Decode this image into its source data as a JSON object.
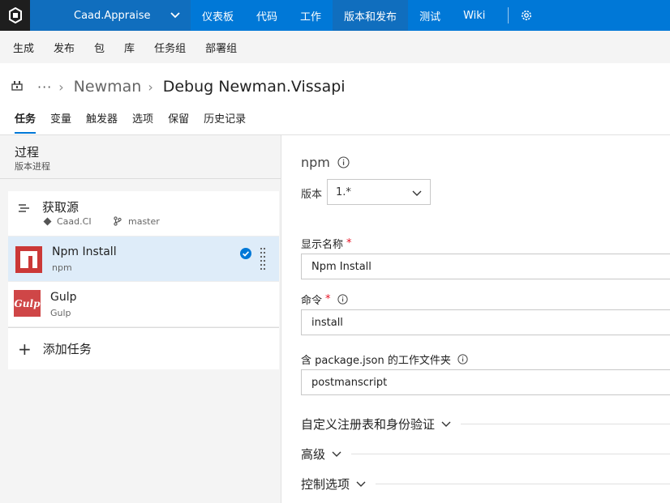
{
  "topbar": {
    "project_name": "Caad.Appraise",
    "nav": [
      "仪表板",
      "代码",
      "工作",
      "版本和发布",
      "测试",
      "Wiki"
    ],
    "active_nav": "版本和发布"
  },
  "subnav": [
    "生成",
    "发布",
    "包",
    "库",
    "任务组",
    "部署组"
  ],
  "breadcrumb": {
    "dots": "···",
    "parent": "Newman",
    "title": "Debug Newman.Vissapi"
  },
  "tabs": [
    "任务",
    "变量",
    "触发器",
    "选项",
    "保留",
    "历史记录"
  ],
  "process": {
    "title": "过程",
    "subtitle": "版本进程"
  },
  "tasks": {
    "source": {
      "name": "获取源",
      "repo": "Caad.CI",
      "branch": "master"
    },
    "npm": {
      "name": "Npm Install",
      "sub": "npm"
    },
    "gulp": {
      "name": "Gulp",
      "sub": "Gulp",
      "logo_text": "Gulp"
    },
    "add": "添加任务"
  },
  "detail": {
    "title": "npm",
    "version_label": "版本",
    "version_value": "1.*",
    "display_name_label": "显示名称",
    "display_name_value": "Npm Install",
    "command_label": "命令",
    "command_value": "install",
    "folder_label": "含 package.json 的工作文件夹",
    "folder_value": "postmanscript",
    "required_mark": "*",
    "sections": [
      "自定义注册表和身份验证",
      "高级",
      "控制选项"
    ]
  },
  "colors": {
    "brand": "#0078d7",
    "selected": "#deecf9",
    "npm_red": "#cb3837",
    "gulp_red": "#cf4647",
    "check": "#0078d7"
  }
}
